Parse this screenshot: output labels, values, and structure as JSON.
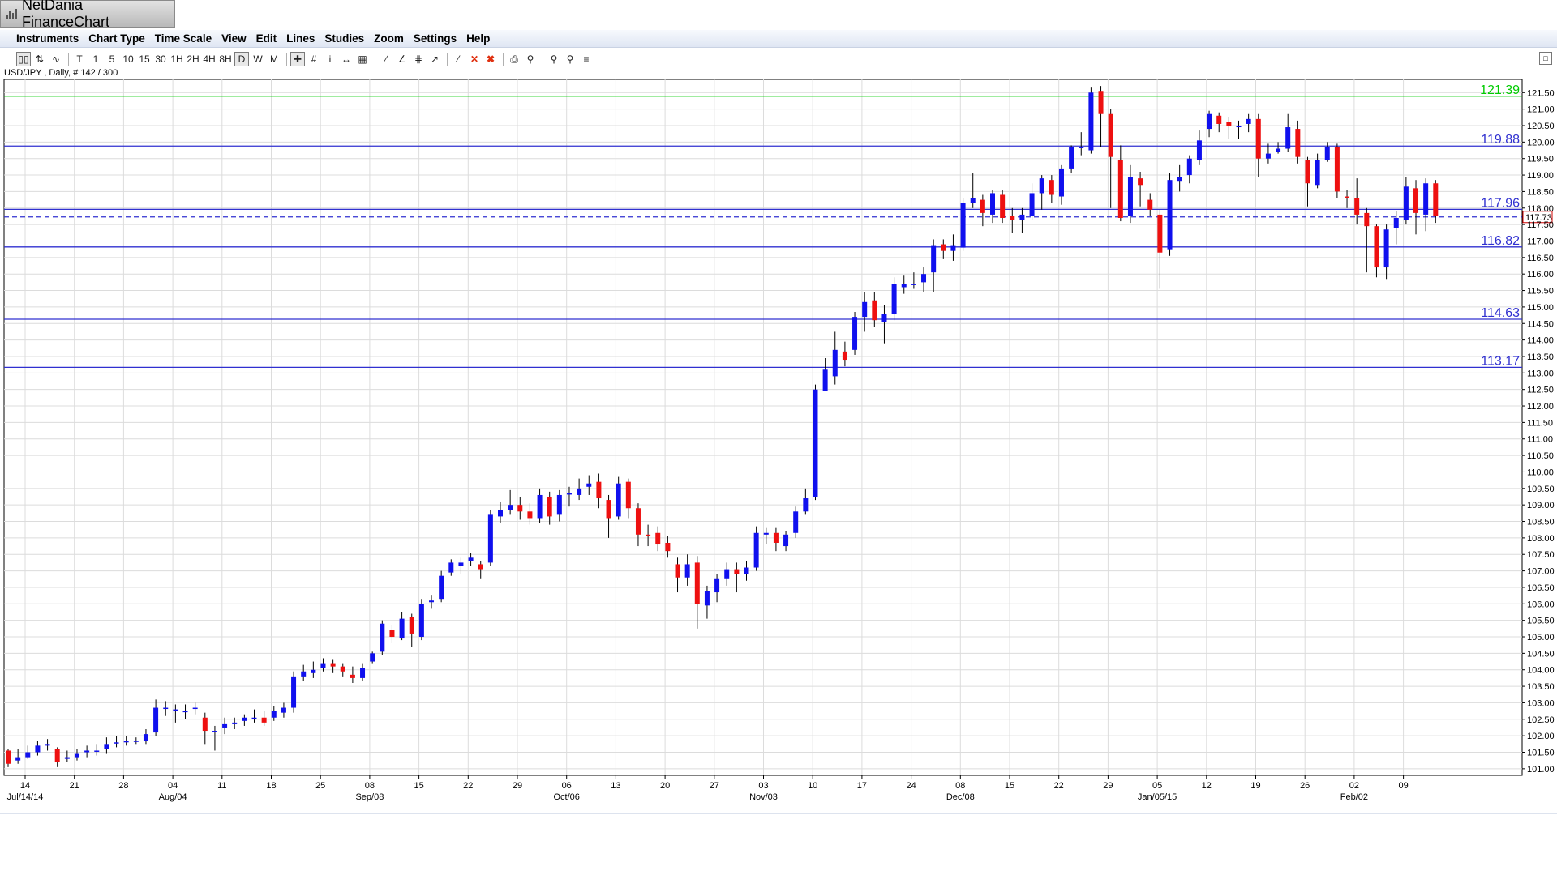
{
  "app": {
    "title": "NetDania FinanceChart"
  },
  "menu": [
    "Instruments",
    "Chart Type",
    "Time Scale",
    "View",
    "Edit",
    "Lines",
    "Studies",
    "Zoom",
    "Settings",
    "Help"
  ],
  "toolbar": {
    "timeframes": [
      "T",
      "1",
      "5",
      "10",
      "15",
      "30",
      "1H",
      "2H",
      "4H",
      "8H",
      "D",
      "W",
      "M"
    ],
    "active_timeframe": "D"
  },
  "symbol_info": "USD/JPY , Daily, # 142 / 300",
  "colors": {
    "up": "#1010ee",
    "down": "#ee1010",
    "green_line": "#00cc00",
    "hline": "#3030d0",
    "grid": "#dcdcdc"
  },
  "chart_data": {
    "type": "candlestick",
    "ylim": [
      100.8,
      121.9
    ],
    "y_ticks": [
      "101.00",
      "101.50",
      "102.00",
      "102.50",
      "103.00",
      "103.50",
      "104.00",
      "104.50",
      "105.00",
      "105.50",
      "106.00",
      "106.50",
      "107.00",
      "107.50",
      "108.00",
      "108.50",
      "109.00",
      "109.50",
      "110.00",
      "110.50",
      "111.00",
      "111.50",
      "112.00",
      "112.50",
      "113.00",
      "113.50",
      "114.00",
      "114.50",
      "115.00",
      "115.50",
      "116.00",
      "116.50",
      "117.00",
      "117.50",
      "118.00",
      "118.50",
      "119.00",
      "119.50",
      "120.00",
      "120.50",
      "121.00",
      "121.50"
    ],
    "x_ticks": [
      {
        "day": "14",
        "month": "Jul/14/14"
      },
      {
        "day": "21",
        "month": ""
      },
      {
        "day": "28",
        "month": ""
      },
      {
        "day": "04",
        "month": "Aug/04"
      },
      {
        "day": "11",
        "month": ""
      },
      {
        "day": "18",
        "month": ""
      },
      {
        "day": "25",
        "month": ""
      },
      {
        "day": "08",
        "month": "Sep/08"
      },
      {
        "day": "15",
        "month": ""
      },
      {
        "day": "22",
        "month": ""
      },
      {
        "day": "29",
        "month": ""
      },
      {
        "day": "06",
        "month": "Oct/06"
      },
      {
        "day": "13",
        "month": ""
      },
      {
        "day": "20",
        "month": ""
      },
      {
        "day": "27",
        "month": ""
      },
      {
        "day": "03",
        "month": "Nov/03"
      },
      {
        "day": "10",
        "month": ""
      },
      {
        "day": "17",
        "month": ""
      },
      {
        "day": "24",
        "month": ""
      },
      {
        "day": "08",
        "month": "Dec/08"
      },
      {
        "day": "15",
        "month": ""
      },
      {
        "day": "22",
        "month": ""
      },
      {
        "day": "29",
        "month": ""
      },
      {
        "day": "05",
        "month": "Jan/05/15"
      },
      {
        "day": "12",
        "month": ""
      },
      {
        "day": "19",
        "month": ""
      },
      {
        "day": "26",
        "month": ""
      },
      {
        "day": "02",
        "month": "Feb/02"
      },
      {
        "day": "09",
        "month": ""
      }
    ],
    "horizontal_lines": [
      {
        "value": 121.39,
        "label": "121.39",
        "color": "#00cc00",
        "style": "solid"
      },
      {
        "value": 119.88,
        "label": "119.88",
        "color": "#3030d0",
        "style": "solid"
      },
      {
        "value": 117.96,
        "label": "117.96",
        "color": "#3030d0",
        "style": "solid"
      },
      {
        "value": 116.82,
        "label": "116.82",
        "color": "#3030d0",
        "style": "solid"
      },
      {
        "value": 114.63,
        "label": "114.63",
        "color": "#3030d0",
        "style": "solid"
      },
      {
        "value": 113.17,
        "label": "113.17",
        "color": "#3030d0",
        "style": "solid"
      }
    ],
    "last_price": {
      "value": 117.73,
      "label": "117.73"
    },
    "candles": [
      [
        101.55,
        101.15,
        101.6,
        101.05
      ],
      [
        101.25,
        101.35,
        101.6,
        101.15
      ],
      [
        101.35,
        101.5,
        101.7,
        101.3
      ],
      [
        101.5,
        101.7,
        101.85,
        101.4
      ],
      [
        101.7,
        101.75,
        101.9,
        101.55
      ],
      [
        101.6,
        101.2,
        101.65,
        101.05
      ],
      [
        101.3,
        101.35,
        101.55,
        101.2
      ],
      [
        101.35,
        101.45,
        101.6,
        101.25
      ],
      [
        101.5,
        101.55,
        101.7,
        101.35
      ],
      [
        101.55,
        101.55,
        101.75,
        101.4
      ],
      [
        101.6,
        101.75,
        101.95,
        101.45
      ],
      [
        101.8,
        101.8,
        102.0,
        101.65
      ],
      [
        101.8,
        101.85,
        102.0,
        101.7
      ],
      [
        101.85,
        101.85,
        101.95,
        101.75
      ],
      [
        101.85,
        102.05,
        102.2,
        101.75
      ],
      [
        102.1,
        102.85,
        103.1,
        102.0
      ],
      [
        102.85,
        102.85,
        103.05,
        102.6
      ],
      [
        102.8,
        102.8,
        102.95,
        102.4
      ],
      [
        102.75,
        102.75,
        102.95,
        102.5
      ],
      [
        102.85,
        102.85,
        103.0,
        102.65
      ],
      [
        102.55,
        102.15,
        102.7,
        101.75
      ],
      [
        102.15,
        102.15,
        102.3,
        101.55
      ],
      [
        102.25,
        102.35,
        102.55,
        102.05
      ],
      [
        102.35,
        102.4,
        102.55,
        102.2
      ],
      [
        102.45,
        102.55,
        102.65,
        102.3
      ],
      [
        102.55,
        102.55,
        102.8,
        102.4
      ],
      [
        102.55,
        102.4,
        102.75,
        102.3
      ],
      [
        102.55,
        102.75,
        102.9,
        102.45
      ],
      [
        102.7,
        102.85,
        103.0,
        102.55
      ],
      [
        102.85,
        103.8,
        103.95,
        102.7
      ],
      [
        103.8,
        103.95,
        104.15,
        103.65
      ],
      [
        103.9,
        104.0,
        104.25,
        103.75
      ],
      [
        104.05,
        104.2,
        104.35,
        103.95
      ],
      [
        104.2,
        104.1,
        104.3,
        103.9
      ],
      [
        104.1,
        103.95,
        104.2,
        103.8
      ],
      [
        103.85,
        103.75,
        104.1,
        103.6
      ],
      [
        103.75,
        104.05,
        104.2,
        103.65
      ],
      [
        104.25,
        104.5,
        104.55,
        104.2
      ],
      [
        104.55,
        105.4,
        105.5,
        104.45
      ],
      [
        105.2,
        105.0,
        105.35,
        104.8
      ],
      [
        104.95,
        105.55,
        105.75,
        104.9
      ],
      [
        105.6,
        105.1,
        105.7,
        104.7
      ],
      [
        105.0,
        106.0,
        106.15,
        104.9
      ],
      [
        106.05,
        106.1,
        106.25,
        105.85
      ],
      [
        106.15,
        106.85,
        107.0,
        106.05
      ],
      [
        106.95,
        107.25,
        107.35,
        106.85
      ],
      [
        107.15,
        107.25,
        107.4,
        106.9
      ],
      [
        107.3,
        107.4,
        107.55,
        107.15
      ],
      [
        107.2,
        107.05,
        107.3,
        106.75
      ],
      [
        107.25,
        108.7,
        108.85,
        107.15
      ],
      [
        108.65,
        108.85,
        109.1,
        108.45
      ],
      [
        108.85,
        109.0,
        109.45,
        108.7
      ],
      [
        109.0,
        108.8,
        109.25,
        108.55
      ],
      [
        108.8,
        108.6,
        109.05,
        108.4
      ],
      [
        108.6,
        109.3,
        109.5,
        108.45
      ],
      [
        109.25,
        108.65,
        109.4,
        108.4
      ],
      [
        108.7,
        109.3,
        109.45,
        108.5
      ],
      [
        109.35,
        109.35,
        109.55,
        108.95
      ],
      [
        109.3,
        109.5,
        109.8,
        109.15
      ],
      [
        109.55,
        109.65,
        109.9,
        109.3
      ],
      [
        109.7,
        109.2,
        109.95,
        108.9
      ],
      [
        109.15,
        108.6,
        109.3,
        108.0
      ],
      [
        108.65,
        109.65,
        109.85,
        108.55
      ],
      [
        109.7,
        108.9,
        109.8,
        108.6
      ],
      [
        108.9,
        108.1,
        109.05,
        107.75
      ],
      [
        108.1,
        108.05,
        108.4,
        107.75
      ],
      [
        108.15,
        107.8,
        108.35,
        107.6
      ],
      [
        107.85,
        107.6,
        108.05,
        107.4
      ],
      [
        107.2,
        106.8,
        107.4,
        106.35
      ],
      [
        106.8,
        107.2,
        107.5,
        106.55
      ],
      [
        107.25,
        106.0,
        107.45,
        105.25
      ],
      [
        105.95,
        106.4,
        106.55,
        105.55
      ],
      [
        106.35,
        106.75,
        106.9,
        106.05
      ],
      [
        106.75,
        107.05,
        107.25,
        106.55
      ],
      [
        107.05,
        106.9,
        107.25,
        106.35
      ],
      [
        106.9,
        107.1,
        107.3,
        106.7
      ],
      [
        107.1,
        108.15,
        108.35,
        107.0
      ],
      [
        108.1,
        108.15,
        108.3,
        107.8
      ],
      [
        108.15,
        107.85,
        108.3,
        107.6
      ],
      [
        107.75,
        108.1,
        108.2,
        107.6
      ],
      [
        108.15,
        108.8,
        108.95,
        108.0
      ],
      [
        108.8,
        109.2,
        109.5,
        108.7
      ],
      [
        109.25,
        112.5,
        112.65,
        109.15
      ],
      [
        112.45,
        113.1,
        113.45,
        112.75
      ],
      [
        112.9,
        113.7,
        114.25,
        112.65
      ],
      [
        113.65,
        113.4,
        113.95,
        113.2
      ],
      [
        113.7,
        114.7,
        114.85,
        113.55
      ],
      [
        114.7,
        115.15,
        115.45,
        114.25
      ],
      [
        115.2,
        114.6,
        115.45,
        114.4
      ],
      [
        114.55,
        114.8,
        115.05,
        113.9
      ],
      [
        114.8,
        115.7,
        115.9,
        114.6
      ],
      [
        115.6,
        115.7,
        115.95,
        115.4
      ],
      [
        115.7,
        115.7,
        116.05,
        115.55
      ],
      [
        115.75,
        116.0,
        116.2,
        115.45
      ],
      [
        116.05,
        116.85,
        117.05,
        115.45
      ],
      [
        116.9,
        116.7,
        117.05,
        116.45
      ],
      [
        116.7,
        116.85,
        117.2,
        116.4
      ],
      [
        116.8,
        118.15,
        118.3,
        116.7
      ],
      [
        118.15,
        118.3,
        119.05,
        118.0
      ],
      [
        118.25,
        117.85,
        118.4,
        117.45
      ],
      [
        117.8,
        118.45,
        118.55,
        117.55
      ],
      [
        118.4,
        117.7,
        118.55,
        117.55
      ],
      [
        117.75,
        117.65,
        118.0,
        117.25
      ],
      [
        117.65,
        117.8,
        118.0,
        117.25
      ],
      [
        117.75,
        118.45,
        118.75,
        117.65
      ],
      [
        118.45,
        118.9,
        119.0,
        117.95
      ],
      [
        118.85,
        118.4,
        119.0,
        118.15
      ],
      [
        118.35,
        119.2,
        119.3,
        118.1
      ],
      [
        119.2,
        119.85,
        119.9,
        119.05
      ],
      [
        119.85,
        119.85,
        120.3,
        119.6
      ],
      [
        119.75,
        121.5,
        121.65,
        119.65
      ],
      [
        121.55,
        120.85,
        121.7,
        119.85
      ],
      [
        120.85,
        119.55,
        121.0,
        118.0
      ],
      [
        119.45,
        117.7,
        119.9,
        117.6
      ],
      [
        117.75,
        118.95,
        119.3,
        117.55
      ],
      [
        118.9,
        118.7,
        119.1,
        118.05
      ],
      [
        118.25,
        117.95,
        118.45,
        117.75
      ],
      [
        117.8,
        116.65,
        117.95,
        115.55
      ],
      [
        116.75,
        118.85,
        119.05,
        116.55
      ],
      [
        118.8,
        118.95,
        119.3,
        118.5
      ],
      [
        119.0,
        119.5,
        119.6,
        118.75
      ],
      [
        119.45,
        120.05,
        120.35,
        119.3
      ],
      [
        120.4,
        120.85,
        120.95,
        120.15
      ],
      [
        120.8,
        120.55,
        120.9,
        120.3
      ],
      [
        120.6,
        120.5,
        120.75,
        120.1
      ],
      [
        120.45,
        120.5,
        120.65,
        120.1
      ],
      [
        120.55,
        120.7,
        120.85,
        120.3
      ],
      [
        120.7,
        119.5,
        120.85,
        118.95
      ],
      [
        119.5,
        119.65,
        119.95,
        119.35
      ],
      [
        119.7,
        119.8,
        120.0,
        119.65
      ],
      [
        119.8,
        120.45,
        120.85,
        119.7
      ],
      [
        120.4,
        119.55,
        120.65,
        119.35
      ],
      [
        119.45,
        118.75,
        119.55,
        118.05
      ],
      [
        118.7,
        119.45,
        119.65,
        118.6
      ],
      [
        119.45,
        119.85,
        120.0,
        119.4
      ],
      [
        119.85,
        118.5,
        119.95,
        118.3
      ],
      [
        118.35,
        118.3,
        118.55,
        118.0
      ],
      [
        118.3,
        117.8,
        118.9,
        117.5
      ],
      [
        117.85,
        117.45,
        118.0,
        116.05
      ],
      [
        117.45,
        116.2,
        117.5,
        115.9
      ],
      [
        116.2,
        117.35,
        117.5,
        115.85
      ],
      [
        117.4,
        117.7,
        117.9,
        116.9
      ],
      [
        117.65,
        118.65,
        118.95,
        117.5
      ],
      [
        118.6,
        117.85,
        118.85,
        117.2
      ],
      [
        117.8,
        118.75,
        118.9,
        117.3
      ],
      [
        118.75,
        117.75,
        118.85,
        117.55
      ]
    ]
  }
}
